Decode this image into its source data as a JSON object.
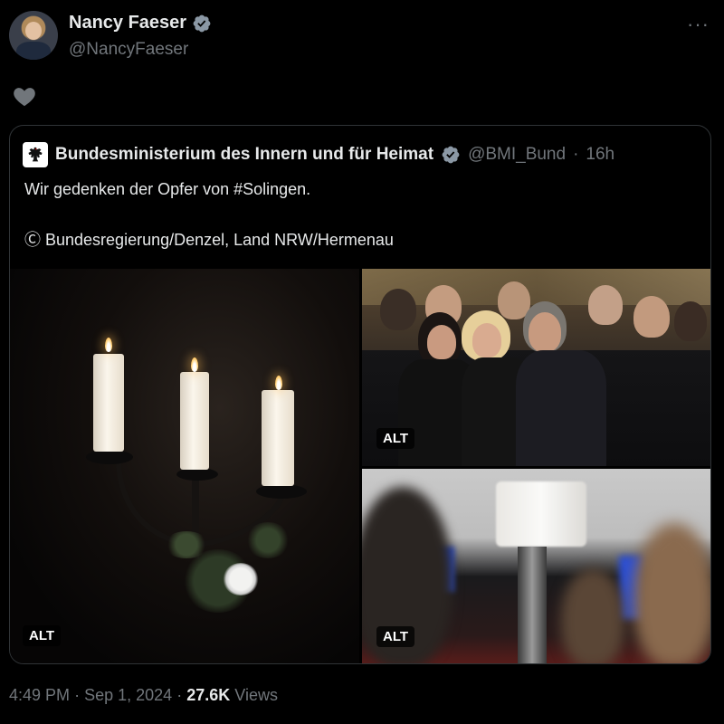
{
  "author": {
    "name": "Nancy Faeser",
    "handle": "@NancyFaeser",
    "verified": true,
    "verified_color": "#8b98a5"
  },
  "icons": {
    "more": "more-icon",
    "like": "heart-icon"
  },
  "quoted": {
    "name": "Bundesministerium des Innern und für Heimat",
    "handle": "@BMI_Bund",
    "separator": "·",
    "time": "16h",
    "text_line1": "Wir gedenken der Opfer von #Solingen.",
    "text_line2": "Ⓒ Bundesregierung/Denzel, Land NRW/Hermenau",
    "media": [
      {
        "alt_label": "ALT",
        "description": "candles-on-candelabra"
      },
      {
        "alt_label": "ALT",
        "description": "audience-at-memorial"
      },
      {
        "alt_label": "ALT",
        "description": "candle-on-lectern-blurred"
      }
    ]
  },
  "footer": {
    "time": "4:49 PM",
    "separator1": "·",
    "date": "Sep 1, 2024",
    "separator2": "·",
    "views_count": "27.6K",
    "views_label": "Views"
  },
  "colors": {
    "background": "#000000",
    "text_primary": "#e7e9ea",
    "text_secondary": "#71767b",
    "border": "#2f3336"
  }
}
